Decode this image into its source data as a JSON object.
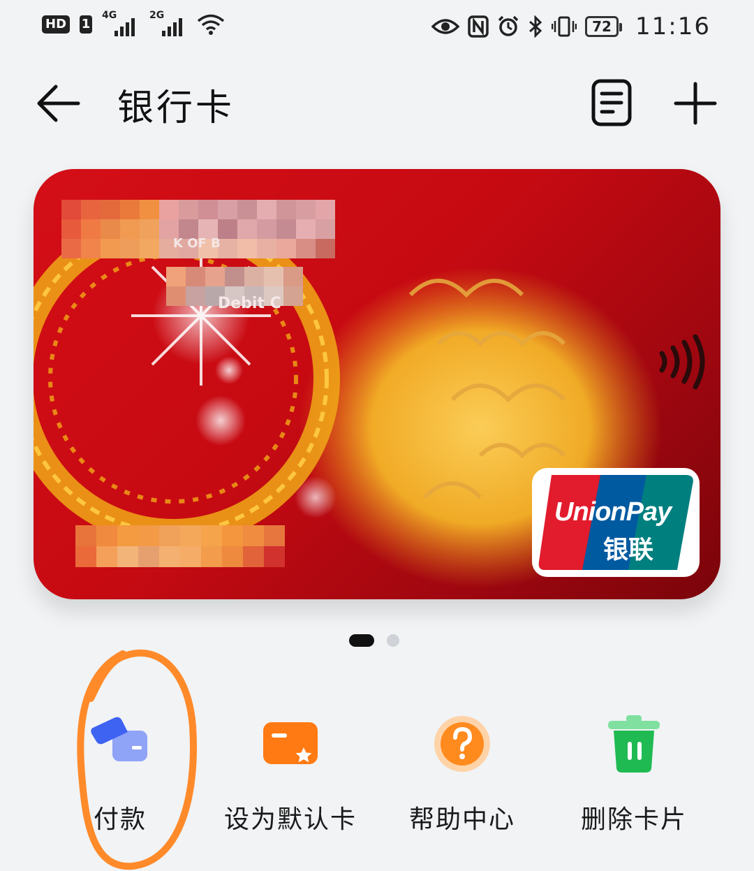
{
  "status_bar": {
    "hd": "HD",
    "sim": "1",
    "network_1": "4G",
    "network_2": "2G",
    "battery": "72",
    "time": "11:16",
    "icons": [
      "eye-icon",
      "nfc-icon",
      "alarm-icon",
      "bluetooth-icon",
      "vibrate-icon",
      "battery-icon",
      "wifi-icon"
    ]
  },
  "header": {
    "title": "银行卡",
    "back_icon": "arrow-left-icon",
    "list_icon": "document-list-icon",
    "add_icon": "plus-icon"
  },
  "card": {
    "type_text": "Debit C",
    "bank_text": "K OF B",
    "brand": "UnionPay",
    "brand_cn": "银联",
    "colors": {
      "card_red": "#c60a12",
      "gold": "#f0b020",
      "up_red": "#e21b2d",
      "up_blue": "#005aa0",
      "up_green": "#007f7f"
    }
  },
  "pager": {
    "count": 2,
    "active": 1
  },
  "actions": [
    {
      "label": "付款",
      "icon": "payment-card-icon",
      "color": "#4f73f5"
    },
    {
      "label": "设为默认卡",
      "icon": "default-card-icon",
      "color": "#ff7a12"
    },
    {
      "label": "帮助中心",
      "icon": "help-icon",
      "color": "#ff8a1e"
    },
    {
      "label": "删除卡片",
      "icon": "trash-icon",
      "color": "#1fba52"
    }
  ],
  "annotation_color": "#ff8a2a"
}
